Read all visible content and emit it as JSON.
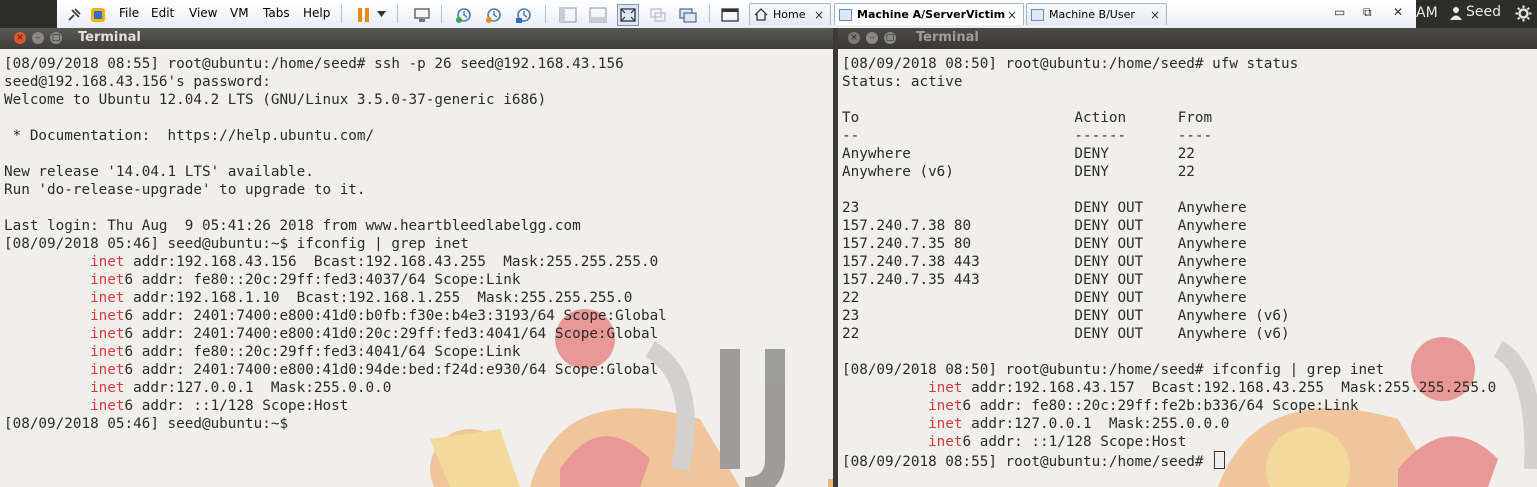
{
  "vmware": {
    "menu": [
      "File",
      "Edit",
      "View",
      "VM",
      "Tabs",
      "Help"
    ],
    "tabs": [
      {
        "label": "Home",
        "active": false
      },
      {
        "label": "Machine A/ServerVictim",
        "active": true
      },
      {
        "label": "Machine B/User",
        "active": false
      }
    ],
    "tab_close": "×",
    "window_controls": {
      "minimize": "▭",
      "restore": "⧉",
      "close": "✕"
    }
  },
  "system_tray": {
    "clock_fragment": "AM",
    "user": "Seed",
    "user_icon": "person-icon",
    "settings_icon": "gear-icon"
  },
  "colors": {
    "keyword_red": "#d63b3b",
    "terminal_bg": "#f0efec",
    "titlebar_active": "#4a4945",
    "close_orange": "#e0562a",
    "wallpaper_orange": "#f2a35a",
    "wallpaper_red": "#e25252"
  },
  "left_terminal": {
    "title": "Terminal",
    "lines": [
      "[08/09/2018 08:55] root@ubuntu:/home/seed# ssh -p 26 seed@192.168.43.156",
      "seed@192.168.43.156's password:",
      "Welcome to Ubuntu 12.04.2 LTS (GNU/Linux 3.5.0-37-generic i686)",
      "",
      " * Documentation:  https://help.ubuntu.com/",
      "",
      "New release '14.04.1 LTS' available.",
      "Run 'do-release-upgrade' to upgrade to it.",
      "",
      "Last login: Thu Aug  9 05:41:26 2018 from www.heartbleedlabelgg.com",
      "[08/09/2018 05:46] seed@ubuntu:~$ ifconfig | grep inet",
      "          inet addr:192.168.43.156  Bcast:192.168.43.255  Mask:255.255.255.0",
      "          inet6 addr: fe80::20c:29ff:fed3:4037/64 Scope:Link",
      "          inet addr:192.168.1.10  Bcast:192.168.1.255  Mask:255.255.255.0",
      "          inet6 addr: 2401:7400:e800:41d0:b0fb:f30e:b4e3:3193/64 Scope:Global",
      "          inet6 addr: 2401:7400:e800:41d0:20c:29ff:fed3:4041/64 Scope:Global",
      "          inet6 addr: fe80::20c:29ff:fed3:4041/64 Scope:Link",
      "          inet6 addr: 2401:7400:e800:41d0:94de:bed:f24d:e930/64 Scope:Global",
      "          inet addr:127.0.0.1  Mask:255.0.0.0",
      "          inet6 addr: ::1/128 Scope:Host",
      "[08/09/2018 05:46] seed@ubuntu:~$ "
    ]
  },
  "right_terminal": {
    "title": "Terminal",
    "lines": [
      "[08/09/2018 08:50] root@ubuntu:/home/seed# ufw status",
      "Status: active",
      "",
      "To                         Action      From",
      "--                         ------      ----",
      "Anywhere                   DENY        22",
      "Anywhere (v6)              DENY        22",
      "",
      "23                         DENY OUT    Anywhere",
      "157.240.7.38 80            DENY OUT    Anywhere",
      "157.240.7.35 80            DENY OUT    Anywhere",
      "157.240.7.38 443           DENY OUT    Anywhere",
      "157.240.7.35 443           DENY OUT    Anywhere",
      "22                         DENY OUT    Anywhere",
      "23                         DENY OUT    Anywhere (v6)",
      "22                         DENY OUT    Anywhere (v6)",
      "",
      "[08/09/2018 08:50] root@ubuntu:/home/seed# ifconfig | grep inet",
      "          inet addr:192.168.43.157  Bcast:192.168.43.255  Mask:255.255.255.0",
      "          inet6 addr: fe80::20c:29ff:fe2b:b336/64 Scope:Link",
      "          inet addr:127.0.0.1  Mask:255.0.0.0",
      "          inet6 addr: ::1/128 Scope:Host",
      "[08/09/2018 08:55] root@ubuntu:/home/seed# "
    ]
  }
}
